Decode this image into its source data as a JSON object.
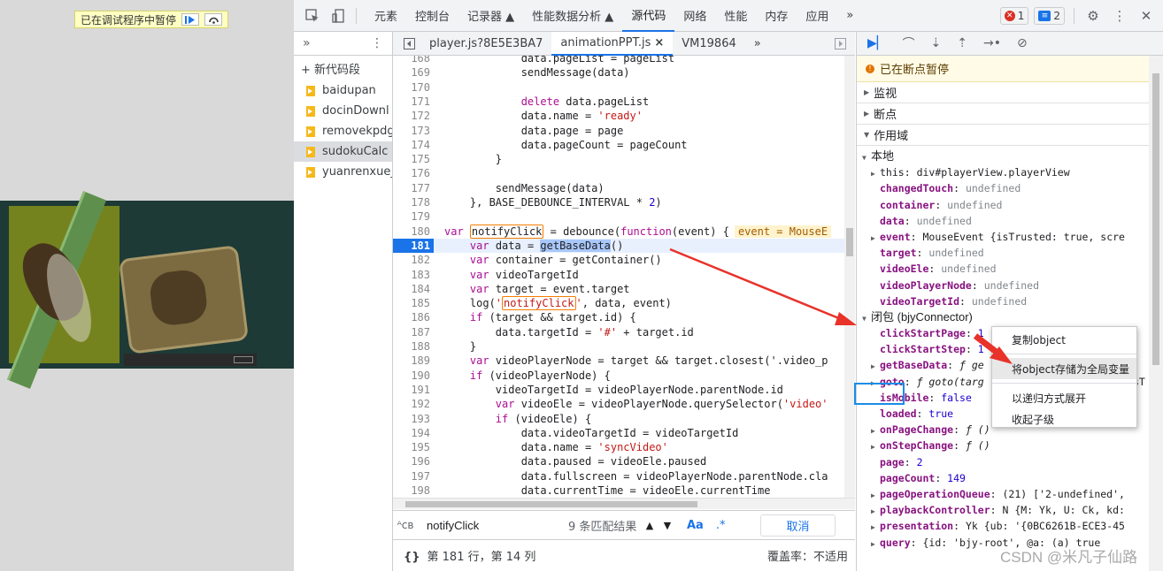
{
  "page_pane": {
    "paused_label": "已在调试程序中暂停"
  },
  "toolbar": {
    "tabs": [
      "元素",
      "控制台",
      "记录器 ▲",
      "性能数据分析 ▲",
      "源代码",
      "网络",
      "性能",
      "内存",
      "应用"
    ],
    "more": "»",
    "errors_count": "1",
    "messages_count": "2"
  },
  "navigator": {
    "more": "»",
    "new_snippet": "+ 新代码段",
    "snippets": [
      "baidupan",
      "docinDownl",
      "removekpdg",
      "sudokuCalc",
      "yuanrenxue_"
    ]
  },
  "editor": {
    "tabs": [
      "player.js?8E5E3BA7",
      "animationPPT.js",
      "VM19864"
    ],
    "close": "×",
    "more": "»",
    "lines": [
      {
        "n": "168",
        "t": "            data.pageList = pageList"
      },
      {
        "n": "169",
        "t": "            sendMessage(data)"
      },
      {
        "n": "170",
        "t": ""
      },
      {
        "n": "171",
        "t": "            delete data.pageList"
      },
      {
        "n": "172",
        "t": "            data.name = 'ready'"
      },
      {
        "n": "173",
        "t": "            data.page = page"
      },
      {
        "n": "174",
        "t": "            data.pageCount = pageCount"
      },
      {
        "n": "175",
        "t": "        }"
      },
      {
        "n": "176",
        "t": ""
      },
      {
        "n": "177",
        "t": "        sendMessage(data)"
      },
      {
        "n": "178",
        "t": "    }, BASE_DEBOUNCE_INTERVAL * 2)"
      },
      {
        "n": "179",
        "t": ""
      },
      {
        "n": "180",
        "t": "var notifyClick = debounce(function(event) {"
      },
      {
        "n": "181",
        "t": "    var data = getBaseData()"
      },
      {
        "n": "182",
        "t": "    var container = getContainer()"
      },
      {
        "n": "183",
        "t": "    var videoTargetId"
      },
      {
        "n": "184",
        "t": "    var target = event.target"
      },
      {
        "n": "185",
        "t": "    log('notifyClick', data, event)"
      },
      {
        "n": "186",
        "t": "    if (target && target.id) {"
      },
      {
        "n": "187",
        "t": "        data.targetId = '#' + target.id"
      },
      {
        "n": "188",
        "t": "    }"
      },
      {
        "n": "189",
        "t": "    var videoPlayerNode = target && target.closest('.video_p"
      },
      {
        "n": "190",
        "t": "    if (videoPlayerNode) {"
      },
      {
        "n": "191",
        "t": "        videoTargetId = videoPlayerNode.parentNode.id"
      },
      {
        "n": "192",
        "t": "        var videoEle = videoPlayerNode.querySelector('video'"
      },
      {
        "n": "193",
        "t": "        if (videoEle) {"
      },
      {
        "n": "194",
        "t": "            data.videoTargetId = videoTargetId"
      },
      {
        "n": "195",
        "t": "            data.name = 'syncVideo'"
      },
      {
        "n": "196",
        "t": "            data.paused = videoEle.paused"
      },
      {
        "n": "197",
        "t": "            data.fullscreen = videoPlayerNode.parentNode.cla"
      },
      {
        "n": "198",
        "t": "            data.currentTime = videoEle.currentTime"
      }
    ],
    "inline_value": "event = MouseE"
  },
  "search": {
    "query": "notifyClick",
    "match_count": "9 条匹配结果",
    "case_label": "Aa",
    "regex_label": ".*",
    "cancel": "取消"
  },
  "status": {
    "braces": "{}",
    "position": "第 181 行，第 14 列",
    "coverage": "覆盖率：不适用"
  },
  "debugger": {
    "paused_message": "已在断点暂停",
    "sections": [
      "监视",
      "断点",
      "作用域"
    ],
    "local_header": "本地",
    "local_rows": [
      {
        "exp": true,
        "k": "this",
        "v": "div#playerView.playerView",
        "c": "obj"
      },
      {
        "k": "changedTouch",
        "v": "undefined",
        "c": "undef"
      },
      {
        "k": "container",
        "v": "undefined",
        "c": "undef"
      },
      {
        "k": "data",
        "v": "undefined",
        "c": "undef"
      },
      {
        "exp": true,
        "k": "event",
        "v": "MouseEvent {isTrusted: true, scre",
        "c": "obj"
      },
      {
        "k": "target",
        "v": "undefined",
        "c": "undef"
      },
      {
        "k": "videoEle",
        "v": "undefined",
        "c": "undef"
      },
      {
        "k": "videoPlayerNode",
        "v": "undefined",
        "c": "undef"
      },
      {
        "k": "videoTargetId",
        "v": "undefined",
        "c": "undef"
      }
    ],
    "closure_header": "闭包 (bjyConnector)",
    "closure_rows": [
      {
        "k": "clickStartPage",
        "v": "1",
        "c": "num"
      },
      {
        "k": "clickStartStep",
        "v": "1",
        "c": "num"
      },
      {
        "exp": true,
        "k": "getBaseData",
        "v": "ƒ ge",
        "c": "fn"
      },
      {
        "exp": true,
        "k": "goto",
        "v": "ƒ goto(targ",
        "c": "fn"
      },
      {
        "k": "isMobile",
        "v": "false",
        "c": "num"
      },
      {
        "k": "loaded",
        "v": "true",
        "c": "num"
      },
      {
        "exp": true,
        "k": "onPageChange",
        "v": "ƒ ()",
        "c": "fn"
      },
      {
        "exp": true,
        "k": "onStepChange",
        "v": "ƒ ()",
        "c": "fn"
      },
      {
        "k": "page",
        "v": "2",
        "c": "num"
      },
      {
        "k": "pageCount",
        "v": "149",
        "c": "num"
      },
      {
        "exp": true,
        "k": "pageOperationQueue",
        "v": "(21) ['2-undefined',",
        "c": "obj"
      },
      {
        "exp": true,
        "k": "playbackController",
        "v": "N {M: Yk, U: Ck, kd:",
        "c": "obj"
      },
      {
        "exp": true,
        "k": "presentation",
        "v": "Yk {ub: '{0BC6261B-ECE3-45",
        "c": "obj"
      },
      {
        "exp": true,
        "k": "query",
        "v": "{id: 'bjy-root', @a: (a) true",
        "c": "obj"
      }
    ],
    "goto_tail": "sT"
  },
  "context_menu": {
    "items": [
      "复制object",
      "将object存储为全局变量",
      "以递归方式展开",
      "收起子级"
    ]
  },
  "watermark": "CSDN @米凡子仙路"
}
